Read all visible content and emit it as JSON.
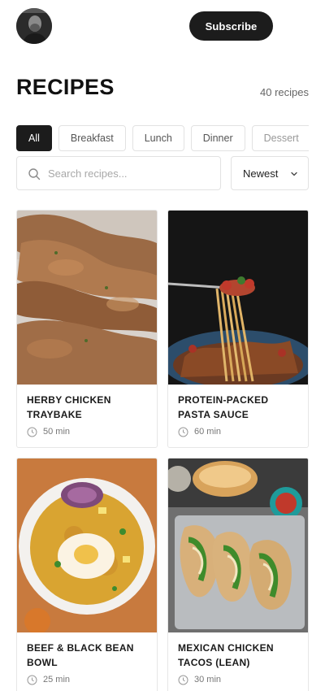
{
  "header": {
    "avatar_icon": "user-avatar",
    "subscribe_label": "Subscribe"
  },
  "page": {
    "title": "RECIPES",
    "count": "40 recipes"
  },
  "filters": [
    "All",
    "Breakfast",
    "Lunch",
    "Dinner",
    "Dessert"
  ],
  "search": {
    "placeholder": "Search recipes...",
    "icon": "search-icon"
  },
  "sort": {
    "selected": "Newest",
    "icon": "chevron-down-icon"
  },
  "recipes": [
    {
      "title": "HERBY CHICKEN TRAYBAKE",
      "time": "50 min"
    },
    {
      "title": "PROTEIN-PACKED PASTA SAUCE",
      "time": "60 min"
    },
    {
      "title": "BEEF & BLACK BEAN BOWL",
      "time": "25 min"
    },
    {
      "title": "MEXICAN CHICKEN TACOS (LEAN)",
      "time": "30 min"
    }
  ],
  "colors": {
    "primary": "#1c1c1c",
    "border": "#e2e2e2",
    "muted_text": "#777777"
  }
}
